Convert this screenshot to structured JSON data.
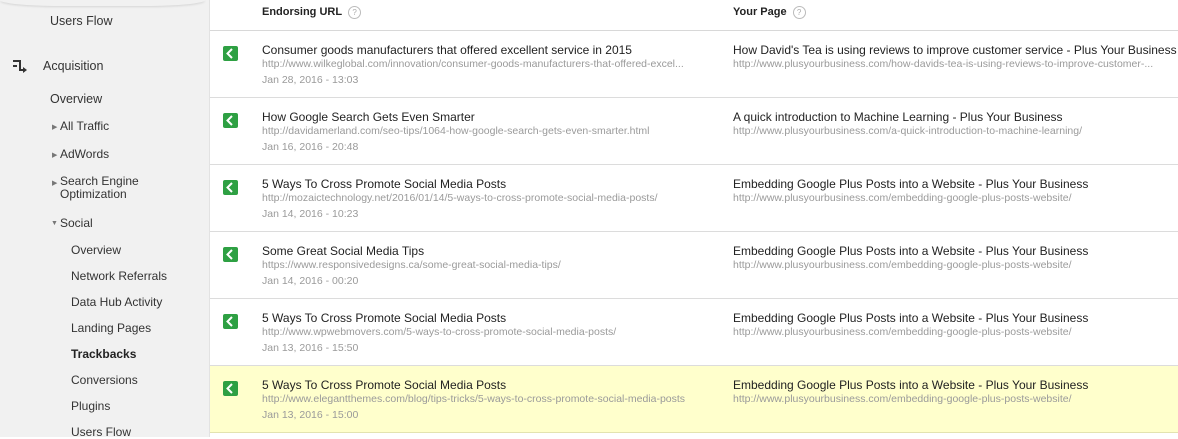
{
  "sidebar": {
    "users_flow_top": "Users Flow",
    "acquisition": "Acquisition",
    "overview": "Overview",
    "all_traffic": "All Traffic",
    "adwords": "AdWords",
    "seo_line1": "Search Engine",
    "seo_line2": "Optimization",
    "social": "Social",
    "social_items": [
      "Overview",
      "Network Referrals",
      "Data Hub Activity",
      "Landing Pages",
      "Trackbacks",
      "Conversions",
      "Plugins",
      "Users Flow"
    ]
  },
  "table": {
    "col_endorsing": "Endorsing URL",
    "col_your_page": "Your Page",
    "help_glyph": "?",
    "rows": [
      {
        "title": "Consumer goods manufacturers that offered excellent service in 2015",
        "url": "http://www.wilkeglobal.com/innovation/consumer-goods-manufacturers-that-offered-excel...",
        "date": "Jan 28, 2016 - 13:03",
        "page_title": "How David's Tea is using reviews to improve customer service - Plus Your Business",
        "page_url": "http://www.plusyourbusiness.com/how-davids-tea-is-using-reviews-to-improve-customer-..."
      },
      {
        "title": "How Google Search Gets Even Smarter",
        "url": "http://davidamerland.com/seo-tips/1064-how-google-search-gets-even-smarter.html",
        "date": "Jan 16, 2016 - 20:48",
        "page_title": "A quick introduction to Machine Learning - Plus Your Business",
        "page_url": "http://www.plusyourbusiness.com/a-quick-introduction-to-machine-learning/"
      },
      {
        "title": "5 Ways To Cross Promote Social Media Posts",
        "url": "http://mozaictechnology.net/2016/01/14/5-ways-to-cross-promote-social-media-posts/",
        "date": "Jan 14, 2016 - 10:23",
        "page_title": "Embedding Google Plus Posts into a Website - Plus Your Business",
        "page_url": "http://www.plusyourbusiness.com/embedding-google-plus-posts-website/"
      },
      {
        "title": "Some Great Social Media Tips",
        "url": "https://www.responsivedesigns.ca/some-great-social-media-tips/",
        "date": "Jan 14, 2016 - 00:20",
        "page_title": "Embedding Google Plus Posts into a Website - Plus Your Business",
        "page_url": "http://www.plusyourbusiness.com/embedding-google-plus-posts-website/"
      },
      {
        "title": "5 Ways To Cross Promote Social Media Posts",
        "url": "http://www.wpwebmovers.com/5-ways-to-cross-promote-social-media-posts/",
        "date": "Jan 13, 2016 - 15:50",
        "page_title": "Embedding Google Plus Posts into a Website - Plus Your Business",
        "page_url": "http://www.plusyourbusiness.com/embedding-google-plus-posts-website/"
      },
      {
        "title": "5 Ways To Cross Promote Social Media Posts",
        "url": "http://www.elegantthemes.com/blog/tips-tricks/5-ways-to-cross-promote-social-media-posts",
        "date": "Jan 13, 2016 - 15:00",
        "page_title": "Embedding Google Plus Posts into a Website - Plus Your Business",
        "page_url": "http://www.plusyourbusiness.com/embedding-google-plus-posts-website/"
      }
    ]
  },
  "icons": {
    "acquisition": "acquisition-arrows-icon",
    "row": "google-plus-activity-icon",
    "help": "help-icon",
    "expand": "triangle-right-icon",
    "collapse": "triangle-down-icon"
  },
  "colors": {
    "highlight_row": "#ffffcc",
    "icon_green": "#2ea043",
    "sidebar_bg": "#f1f1f1"
  }
}
